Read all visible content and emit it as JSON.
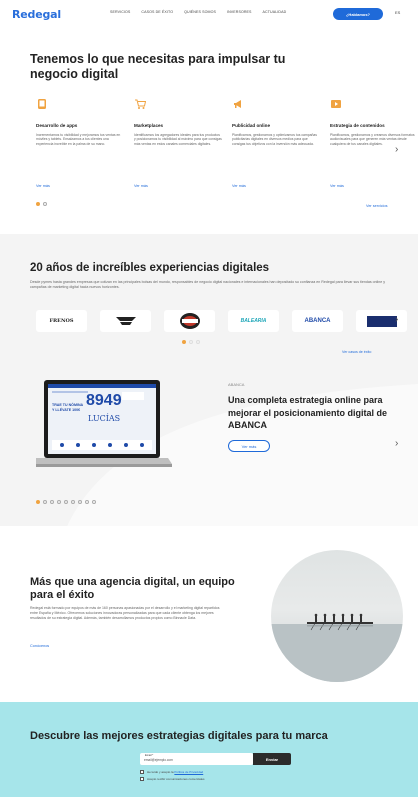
{
  "header": {
    "logo": "Redegal",
    "nav": [
      "SERVICIOS",
      "CASOS DE ÉXITO",
      "QUIÉNES SOMOS",
      "INVERSORES",
      "ACTUALIDAD"
    ],
    "cta": "¿Hablamos?",
    "lang": "ES"
  },
  "services_section": {
    "title": "Tenemos lo que necesitas para impulsar tu negocio digital",
    "items": [
      {
        "title": "Desarrollo de apps",
        "desc": "Incrementamos tu visibilidad y mejoramos tus ventas en móviles y tablets. Ensalzamos a tus clientes una experiencia increíble en la palma de su mano.",
        "link": "Ver más",
        "icon": "app-icon",
        "color": "#f0a341"
      },
      {
        "title": "Marketplaces",
        "desc": "Identificamos los agregadores ideales para tus productos y posicionamos tu visibilidad al máximo para que consigas más ventas en estos canales comerciales digitales.",
        "link": "Ver más",
        "icon": "cart-icon",
        "color": "#f0a341"
      },
      {
        "title": "Publicidad online",
        "desc": "Planificamos, gestionamos y optimizamos tus campañas publicitarias digitales en diversos medios para que consigas tus objetivos con la inversión más adecuada.",
        "link": "Ver más",
        "icon": "megaphone-icon",
        "color": "#f0a341"
      },
      {
        "title": "Estrategia de contenidos",
        "desc": "Planificamos, gestionamos y creamos diversos formatos audiovisuales para que generen más ventas desde cualquiera de tus canales digitales.",
        "link": "Ver más",
        "icon": "content-icon",
        "color": "#f0a341"
      }
    ],
    "all_link": "Ver servicios"
  },
  "cases_section": {
    "title": "20 años de increíbles experiencias digitales",
    "desc": "Desde pymes hasta grandes empresas que cotizan en las principales bolsas del mundo, responsables de negocio digital nacionales e internacionales han depositado su confianza en Redegal para llevar sus tiendas online y campañas de marketing digital hacia nuevos horizontes.",
    "client_logos": [
      "FRENOS",
      "SEAT MOTOR",
      "ESTRELLA GALICIA",
      "BALEARIA",
      "ABANCA",
      "TIENDAS"
    ],
    "all_cases_link": "Ver casos de éxito",
    "featured": {
      "kicker": "ABANCA",
      "title": "Una completa estrategia online para mejorar el posicionamiento digital de ABANCA",
      "button": "Ver más",
      "screen_big": "8949",
      "screen_word": "LUCÍAS",
      "screen_line1": "TRAE TU NÓMINA",
      "screen_line2": "Y LLÉVATE 100€"
    }
  },
  "team_section": {
    "title": "Más que una agencia digital, un equipo para el éxito",
    "desc": "Redegal está formado por equipos de más de 160 personas apasionadas por el desarrollo y el marketing digital repartidos entre España y México. Ofrecemos soluciones innovadoras personalizadas para que cada cliente obtenga los mejores resultados de su estrategia digital. Además, también desarrollamos productos propios como Binnacle Data.",
    "link": "Conócenos"
  },
  "newsletter": {
    "title": "Descubre las mejores estrategias digitales para tu marca",
    "email_label": "Email *",
    "email_value": "email@ejemplo.com",
    "button": "Enviar",
    "consent1_prefix": "He leído y acepto la ",
    "consent1_link": "Política de Privacidad",
    "consent2": "Acepto recibir comunicaciones comerciales"
  }
}
